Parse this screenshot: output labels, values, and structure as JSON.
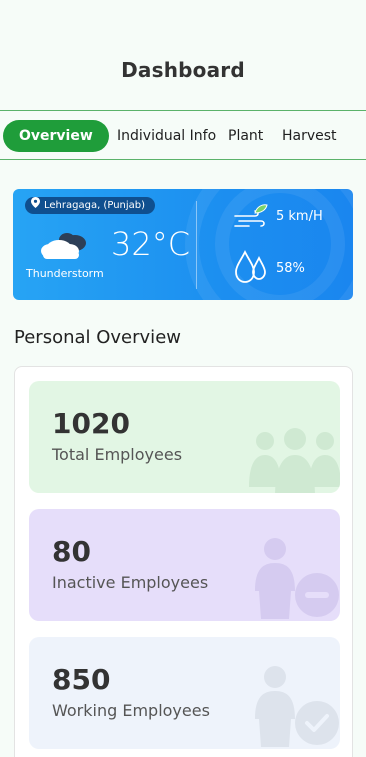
{
  "header": {
    "title": "Dashboard"
  },
  "tabs": [
    {
      "label": "Overview",
      "active": true
    },
    {
      "label": "Individual Info",
      "active": false
    },
    {
      "label": "Plant",
      "active": false
    },
    {
      "label": "Harvest",
      "active": false
    }
  ],
  "weather": {
    "location": "Lehragaga, (Punjab)",
    "temperature": "32°C",
    "condition": "Thunderstorm",
    "wind": "5 km/H",
    "humidity": "58%"
  },
  "section": {
    "title": "Personal Overview"
  },
  "cards": [
    {
      "value": "1020",
      "label": "Total Employees",
      "color": "#e2f6e4",
      "icon": "group-icon"
    },
    {
      "value": "80",
      "label": "Inactive Employees",
      "color": "#e6defa",
      "icon": "person-remove-icon"
    },
    {
      "value": "850",
      "label": "Working Employees",
      "color": "#eef3fb",
      "icon": "person-check-icon"
    }
  ],
  "colors": {
    "accent": "#1f9d3a",
    "weather_bg": "#1c8ff0"
  }
}
